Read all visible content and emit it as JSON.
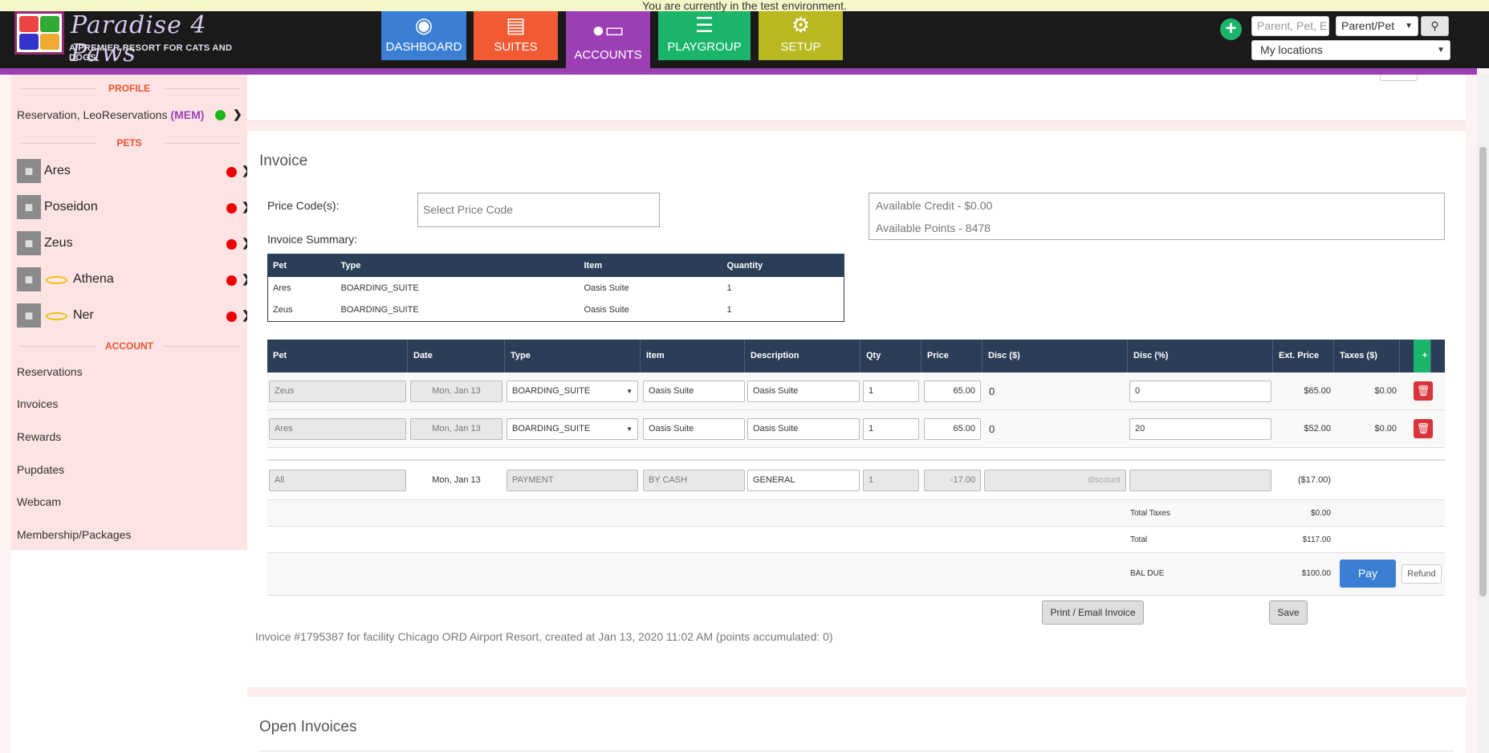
{
  "banner": "You are currently in the test environment.",
  "logo": {
    "title": "Paradise 4 Paws",
    "subtitle": "A PREMIER RESORT FOR CATS AND DOGS"
  },
  "nav": [
    {
      "label": "DASHBOARD",
      "icon": "tag-icon",
      "color": "#3b7fd4"
    },
    {
      "label": "SUITES",
      "icon": "calendar-icon",
      "color": "#f15a33"
    },
    {
      "label": "ACCOUNTS",
      "icon": "account-card-icon",
      "color": "#9c3fb5"
    },
    {
      "label": "PLAYGROUP",
      "icon": "list-icon",
      "color": "#1ab56b"
    },
    {
      "label": "SETUP",
      "icon": "gear-icon",
      "color": "#b8b820"
    }
  ],
  "header": {
    "search_placeholder": "Parent, Pet, E",
    "search_type": "Parent/Pet",
    "location": "My locations"
  },
  "sidebar": {
    "profile_heading": "PROFILE",
    "profile_name": "Reservation, LeoReservations",
    "profile_badge": "(MEM)",
    "pets_heading": "PETS",
    "pets": [
      {
        "name": "Ares",
        "halo": false,
        "status": "red"
      },
      {
        "name": "Poseidon",
        "halo": false,
        "status": "red"
      },
      {
        "name": "Zeus",
        "halo": false,
        "status": "red"
      },
      {
        "name": "Athena",
        "halo": true,
        "status": "red"
      },
      {
        "name": "Ner",
        "halo": true,
        "status": "red"
      }
    ],
    "account_heading": "ACCOUNT",
    "account_items": [
      "Reservations",
      "Invoices",
      "Rewards",
      "Pupdates",
      "Webcam",
      "Membership/Packages"
    ]
  },
  "invoice": {
    "title": "Invoice",
    "price_codes_label": "Price Code(s):",
    "price_code_placeholder": "Select Price Code",
    "summary_label": "Invoice Summary:",
    "available_credit": "Available Credit - $0.00",
    "available_points": "Available Points - 8478",
    "summary_columns": [
      "Pet",
      "Type",
      "Item",
      "Quantity"
    ],
    "summary_rows": [
      [
        "Ares",
        "BOARDING_SUITE",
        "Oasis Suite",
        "1"
      ],
      [
        "Zeus",
        "BOARDING_SUITE",
        "Oasis Suite",
        "1"
      ]
    ],
    "line_columns": [
      "Pet",
      "Date",
      "Type",
      "Item",
      "Description",
      "Qty",
      "Price",
      "Disc ($)",
      "Disc (%)",
      "Ext. Price",
      "Taxes ($)"
    ],
    "lines": [
      {
        "pet": "Zeus",
        "date": "Mon, Jan 13",
        "type": "BOARDING_SUITE",
        "item": "Oasis Suite",
        "description": "Oasis Suite",
        "qty": "1",
        "price": "65.00",
        "disc_amt": "0",
        "disc_pct": "0",
        "ext": "$65.00",
        "tax": "$0.00"
      },
      {
        "pet": "Ares",
        "date": "Mon, Jan 13",
        "type": "BOARDING_SUITE",
        "item": "Oasis Suite",
        "description": "Oasis Suite",
        "qty": "1",
        "price": "65.00",
        "disc_amt": "0",
        "disc_pct": "20",
        "ext": "$52.00",
        "tax": "$0.00"
      }
    ],
    "payment": {
      "pet": "All",
      "date": "Mon, Jan 13",
      "type": "PAYMENT",
      "item": "BY CASH",
      "description": "GENERAL",
      "qty": "1",
      "price": "-17.00",
      "disc_placeholder": "discount",
      "ext": "($17.00)"
    },
    "total_taxes_label": "Total Taxes",
    "total_taxes": "$0.00",
    "total_label": "Total",
    "total": "$117.00",
    "bal_due_label": "BAL DUE",
    "bal_due": "$100.00",
    "pay_label": "Pay",
    "refund_label": "Refund",
    "print_label": "Print / Email Invoice",
    "save_label": "Save",
    "footnote": "Invoice #1795387 for facility Chicago ORD Airport Resort, created at Jan 13, 2020 11:02 AM (points accumulated: 0)"
  },
  "open_invoices_title": "Open Invoices"
}
